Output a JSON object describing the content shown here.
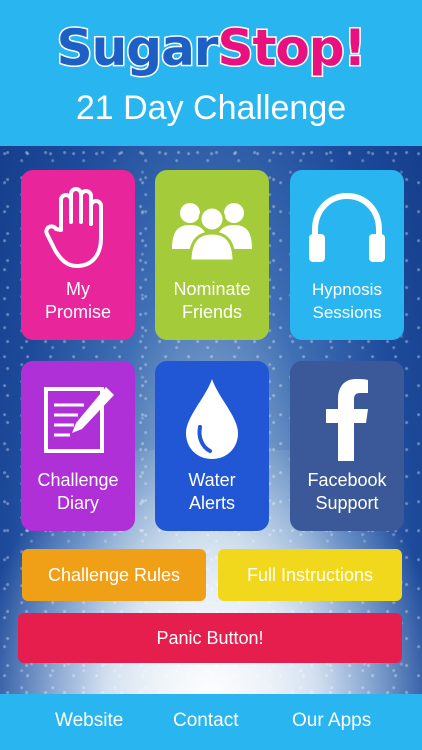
{
  "app": {
    "logo_sugar": "Sugar",
    "logo_stop": "Stop!",
    "subtitle": "21 Day Challenge"
  },
  "tiles": [
    {
      "label_line1": "My",
      "label_line2": "Promise",
      "icon": "hand-icon",
      "color": "#e8259a"
    },
    {
      "label_line1": "Nominate",
      "label_line2": "Friends",
      "icon": "group-icon",
      "color": "#a4cc3a"
    },
    {
      "label_line1": "Hypnosis",
      "label_line2": "Sessions",
      "icon": "headphones-icon",
      "color": "#29b6f0"
    },
    {
      "label_line1": "Challenge",
      "label_line2": "Diary",
      "icon": "diary-icon",
      "color": "#b030d8"
    },
    {
      "label_line1": "Water",
      "label_line2": "Alerts",
      "icon": "water-drop-icon",
      "color": "#2156d4"
    },
    {
      "label_line1": "Facebook",
      "label_line2": "Support",
      "icon": "facebook-icon",
      "color": "#3b5998"
    }
  ],
  "buttons": {
    "challenge_rules": "Challenge Rules",
    "full_instructions": "Full Instructions",
    "panic": "Panic Button!"
  },
  "colors": {
    "header": "#29b6f0",
    "challenge_rules": "#f0a017",
    "full_instructions": "#f2d81c",
    "panic": "#e61e4d"
  },
  "footer": {
    "website": "Website",
    "contact": "Contact",
    "our_apps": "Our Apps"
  }
}
